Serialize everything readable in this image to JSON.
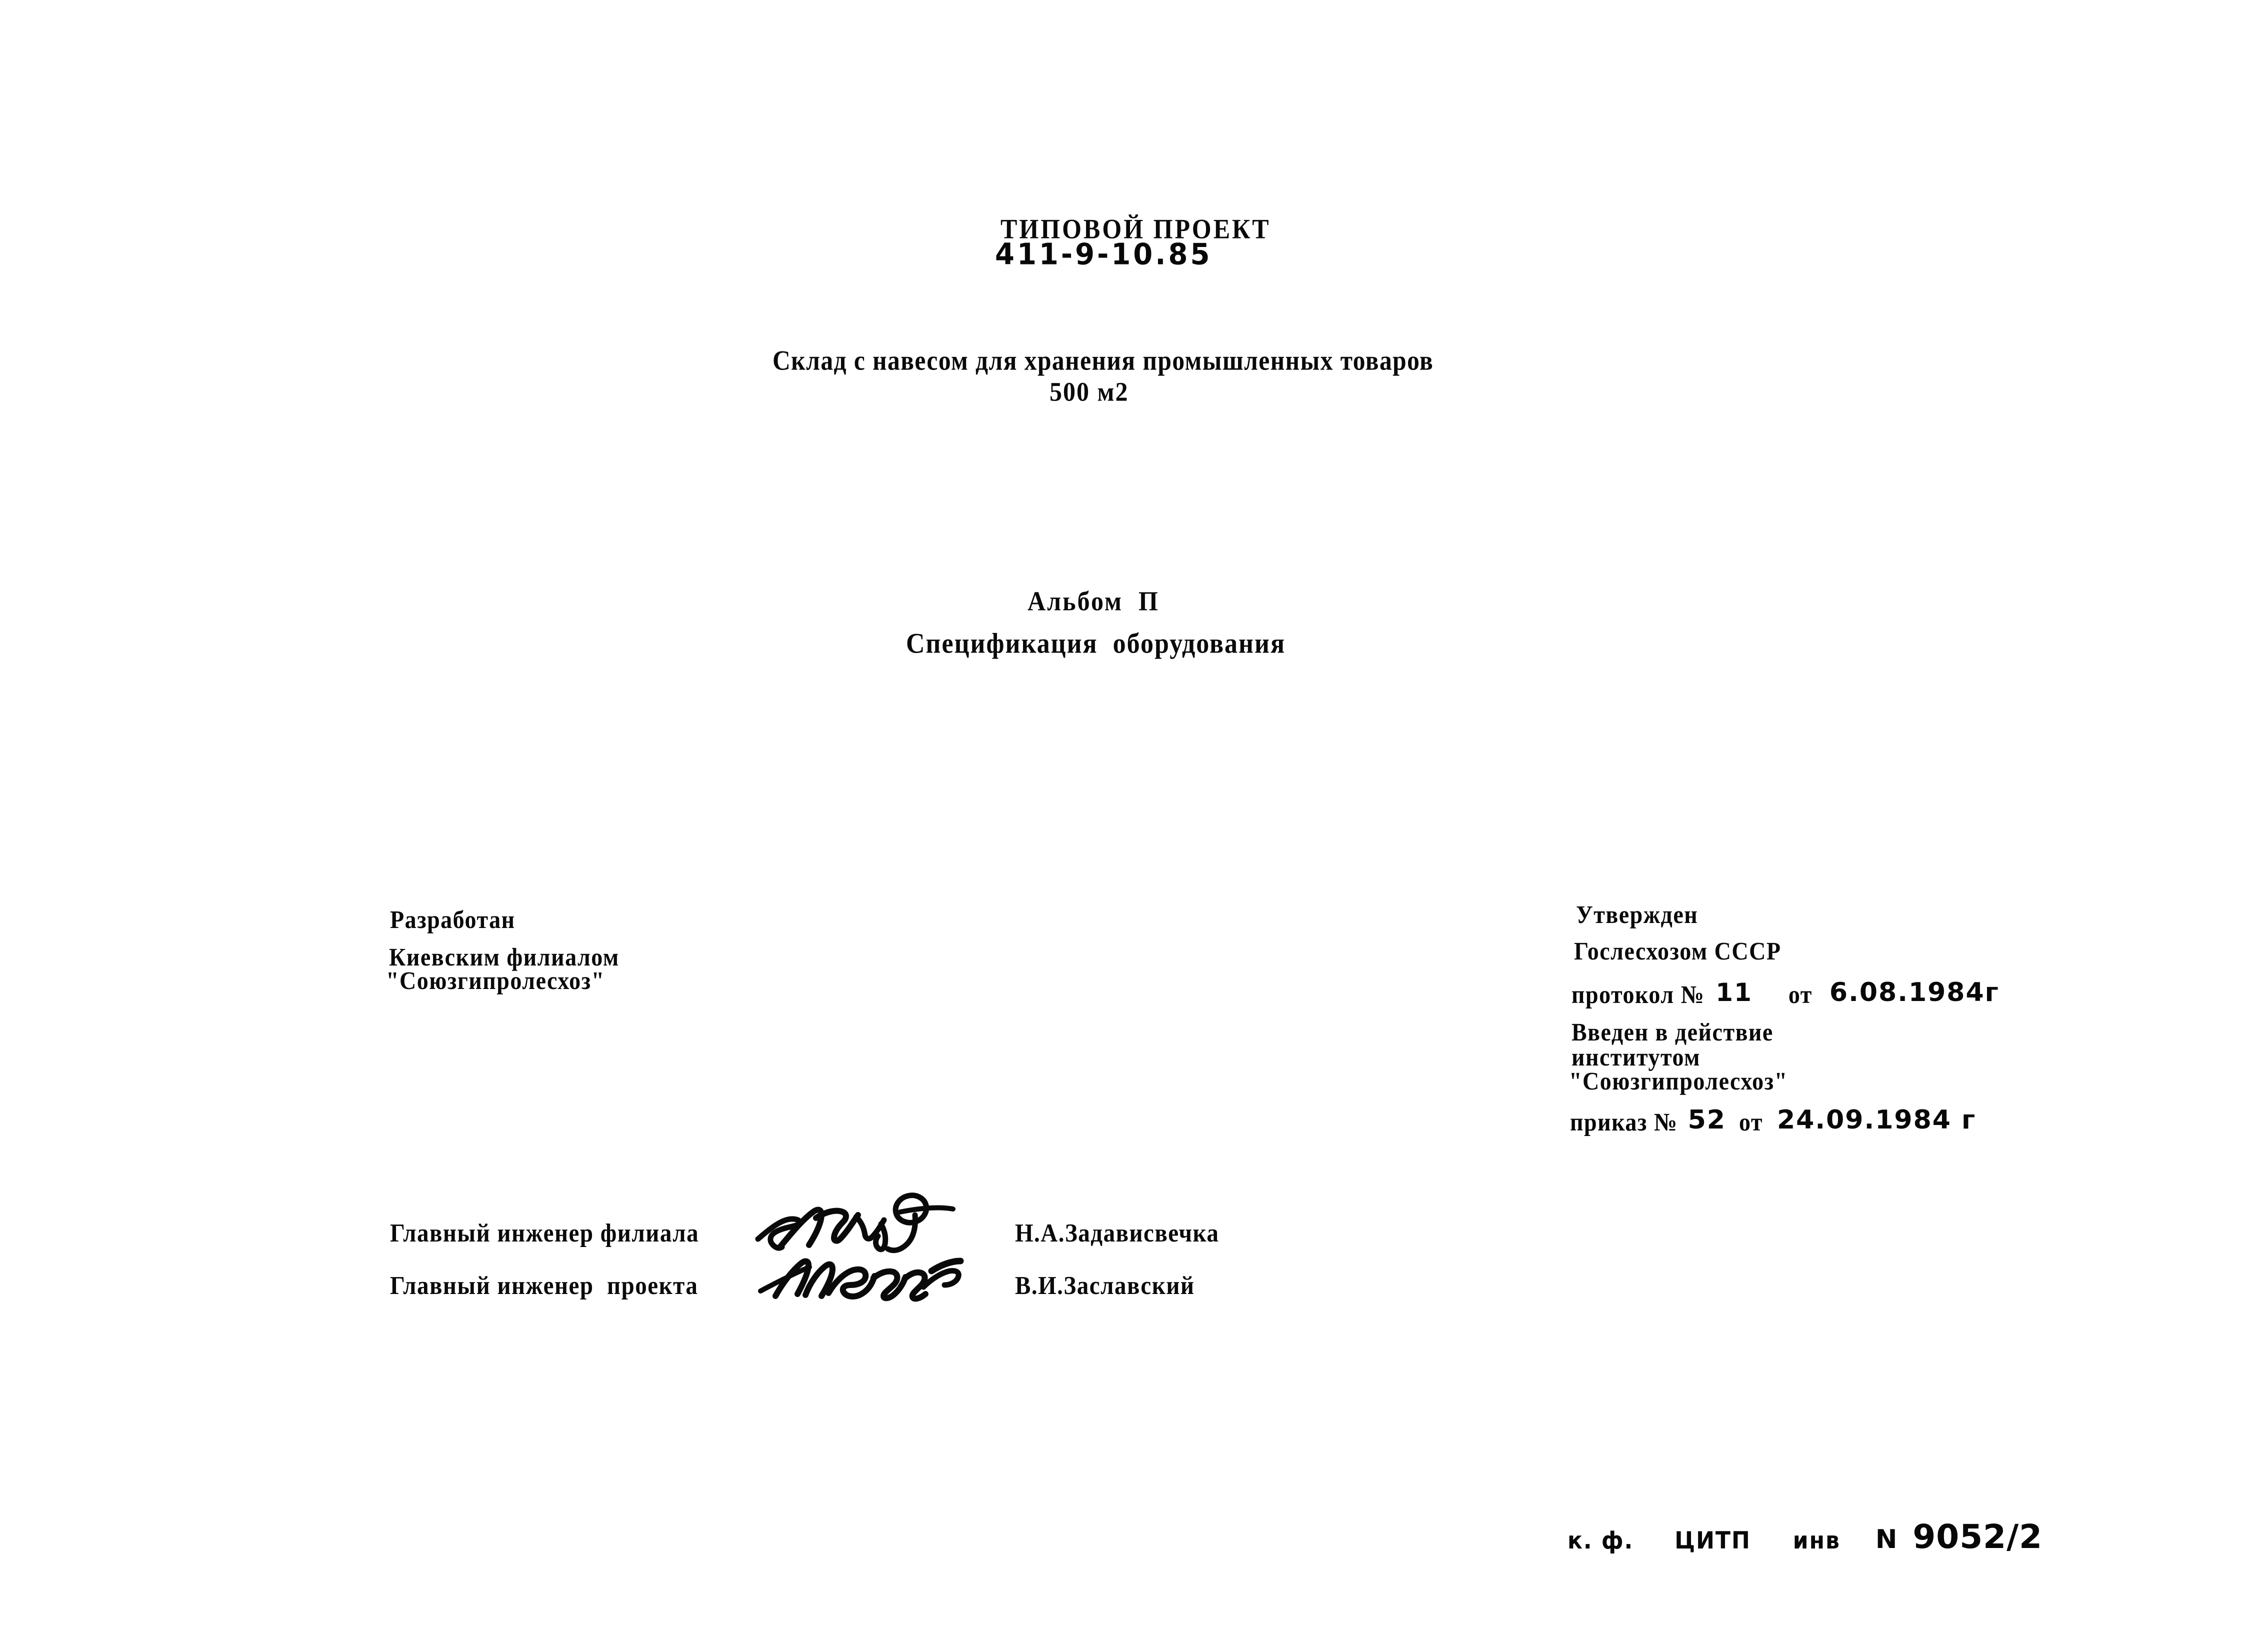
{
  "document": {
    "project_label": "ТИПОВОЙ ПРОЕКТ",
    "project_number": "411-9-10.85",
    "title": "Склад с навесом для хранения промышленных товаров",
    "area": "500 м2",
    "album_label": "Альбом  П",
    "album_subject": "Спецификация  оборудования"
  },
  "developed_by": {
    "heading": "Разработан",
    "line1": "Киевским филиалом",
    "line2": "\"Союзгипролесхоз\""
  },
  "approved_by": {
    "heading": "Утвержден",
    "authority": "Гослесхозом СССР",
    "protocol_prefix": "протокол №",
    "protocol_number": "11",
    "protocol_from_label": "от",
    "protocol_date": "6.08.1984г",
    "enacted_line1": "Введен в действие",
    "enacted_line2": "институтом",
    "enacted_line3": "\"Союзгипролесхоз\"",
    "order_prefix": "приказ №",
    "order_number": "52",
    "order_from_label": "от",
    "order_date": "24.09.1984 г"
  },
  "signatures": [
    {
      "role": "Главный инженер филиала",
      "name": "Н.А.Задависвечка"
    },
    {
      "role": "Главный инженер  проекта",
      "name": "В.И.Заславский"
    }
  ],
  "archive_stamp": {
    "branch": "к. ф.",
    "organization": "ЦИТП",
    "inventory_label": "инв",
    "number_symbol": "N",
    "inventory_number": "9052/2"
  },
  "colors": {
    "ink": "#0a0a0a",
    "paper": "#ffffff"
  }
}
